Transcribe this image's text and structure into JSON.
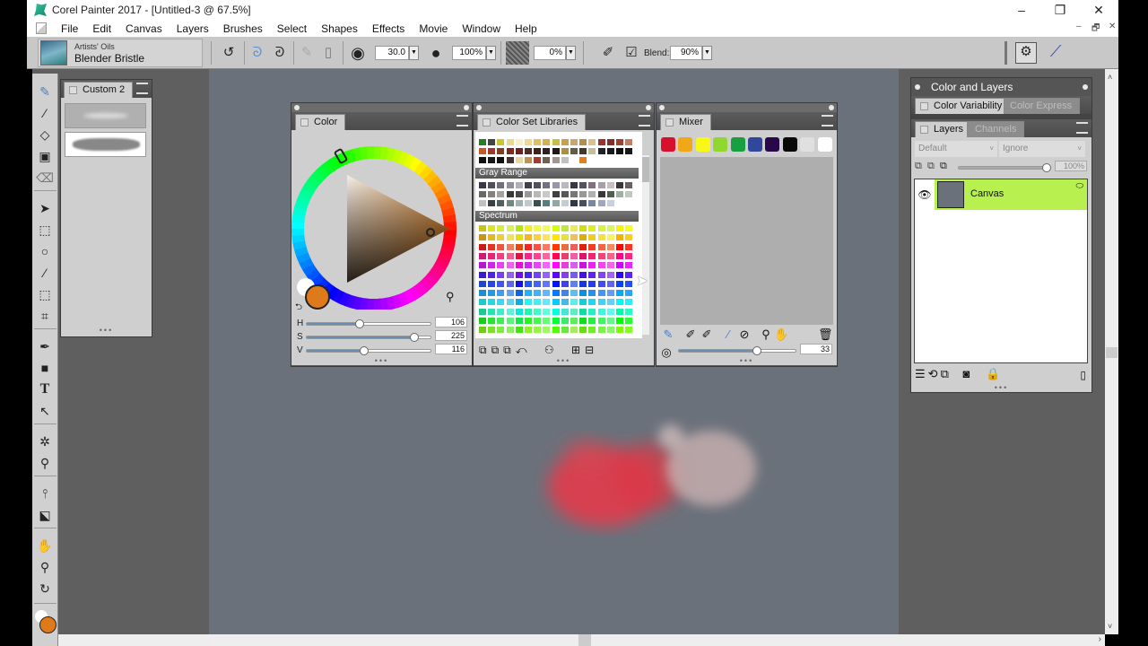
{
  "window": {
    "title": "Corel Painter 2017 - [Untitled-3 @ 67.5%]",
    "controls": {
      "minimize": "–",
      "restore": "❐",
      "close": "✕"
    },
    "mdi_controls": {
      "minimize": "–",
      "restore": "🗗",
      "close": "✕"
    }
  },
  "menu": [
    "File",
    "Edit",
    "Canvas",
    "Layers",
    "Brushes",
    "Select",
    "Shapes",
    "Effects",
    "Movie",
    "Window",
    "Help"
  ],
  "property_bar": {
    "brush_category": "Artists' Oils",
    "brush_variant": "Blender Bristle",
    "size_value": "30.0",
    "opacity_value": "100%",
    "grain_value": "0%",
    "blend_label": "Blend:",
    "blend_value": "90%"
  },
  "custom_palette": {
    "tab": "Custom 2"
  },
  "color_panel": {
    "tab": "Color",
    "main_color": "#de7a1c",
    "secondary_color": "#ffffff",
    "sliders": [
      {
        "label": "H",
        "value": "106",
        "fraction": 0.42
      },
      {
        "label": "S",
        "value": "225",
        "fraction": 0.88
      },
      {
        "label": "V",
        "value": "116",
        "fraction": 0.45
      }
    ]
  },
  "color_set_panel": {
    "tab": "Color Set Libraries",
    "sections": [
      "Gray Range",
      "Spectrum"
    ]
  },
  "mixer_panel": {
    "tab": "Mixer",
    "colors": [
      "#d8102c",
      "#f0a818",
      "#f8f818",
      "#90d830",
      "#18a040",
      "#30489c",
      "#280848",
      "#080808",
      "#e0e0e0",
      "#ffffff"
    ],
    "brush_size_value": "33",
    "brush_size_fraction": 0.66
  },
  "color_layers_panel": {
    "title": "Color and Layers",
    "tabs_top": [
      "Color Variability",
      "Color Express"
    ],
    "tabs_layers": [
      "Layers",
      "Channels"
    ],
    "composite_method": "Default",
    "composite_depth": "Ignore",
    "opacity_value": "100%",
    "opacity_fraction": 1.0,
    "layers": [
      {
        "name": "Canvas",
        "selected": true,
        "highlight": "#b8f050"
      }
    ]
  },
  "toolbox": {
    "main_color": "#de7a1c",
    "secondary_color": "#ffffff"
  }
}
